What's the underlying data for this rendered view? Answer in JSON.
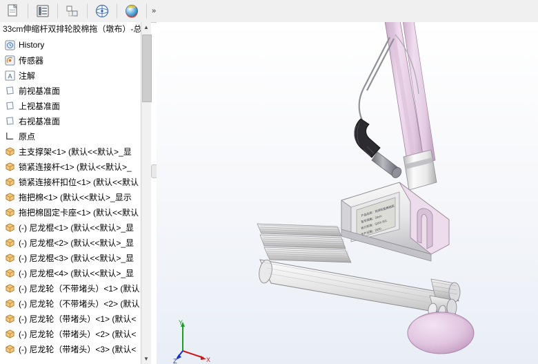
{
  "toolbar": {
    "buttons": [
      {
        "name": "new-document-icon",
        "label": ""
      },
      {
        "name": "list-view-icon",
        "label": ""
      },
      {
        "name": "sketch-icon",
        "label": ""
      },
      {
        "name": "view-orientation-icon",
        "label": ""
      },
      {
        "name": "appearance-sphere-icon",
        "label": ""
      }
    ],
    "overflow_label": "»"
  },
  "tree": {
    "title": "33cm伸缩杆双排轮胶棉拖（墩布）-总",
    "items": [
      {
        "icon": "history-icon",
        "label": "History"
      },
      {
        "icon": "sensor-icon",
        "label": "传感器"
      },
      {
        "icon": "annotation-icon",
        "label": "注解"
      },
      {
        "icon": "plane-icon",
        "label": "前视基准面"
      },
      {
        "icon": "plane-icon",
        "label": "上视基准面"
      },
      {
        "icon": "plane-icon",
        "label": "右视基准面"
      },
      {
        "icon": "origin-icon",
        "label": "原点"
      },
      {
        "icon": "component-icon",
        "label": "主支撑架<1> (默认<<默认>_显"
      },
      {
        "icon": "component-icon",
        "label": "锁紧连接杆<1> (默认<<默认>_"
      },
      {
        "icon": "component-icon",
        "label": "锁紧连接杆扣位<1> (默认<<默认"
      },
      {
        "icon": "component-icon",
        "label": "拖把棉<1> (默认<<默认>_显示"
      },
      {
        "icon": "component-icon",
        "label": "拖把棉固定卡座<1> (默认<<默认"
      },
      {
        "icon": "component-icon",
        "label": "(-) 尼龙棍<1> (默认<<默认>_显"
      },
      {
        "icon": "component-icon",
        "label": "(-) 尼龙棍<2> (默认<<默认>_显"
      },
      {
        "icon": "component-icon",
        "label": "(-) 尼龙棍<3> (默认<<默认>_显"
      },
      {
        "icon": "component-icon",
        "label": "(-) 尼龙棍<4> (默认<<默认>_显"
      },
      {
        "icon": "component-icon",
        "label": "(-) 尼龙轮（不带堵头）<1> (默认"
      },
      {
        "icon": "component-icon",
        "label": "(-) 尼龙轮（不带堵头）<2> (默认"
      },
      {
        "icon": "component-icon",
        "label": "(-) 尼龙轮（带堵头）<1> (默认<"
      },
      {
        "icon": "component-icon",
        "label": "(-) 尼龙轮（带堵头）<2> (默认<"
      },
      {
        "icon": "component-icon",
        "label": "(-) 尼龙轮（带堵头）<3> (默认<"
      }
    ],
    "scrollbar": {
      "up_arrow": "▲",
      "down_arrow": "▼"
    }
  },
  "graphics": {
    "triad": {
      "x_label": "X",
      "y_label": "Y",
      "z_label": "Z"
    },
    "plate_lines": [
      "产品名称：双排轮胶棉拖把",
      "型号规格：33cm",
      "执行标准：Q/XX 001",
      "生产日期：2020"
    ]
  },
  "colors": {
    "body_pink": "#e8d3e6",
    "body_white": "#f4f4f4",
    "metal_grey": "#9a9aa2",
    "accent_blue": "#2a5db0"
  }
}
